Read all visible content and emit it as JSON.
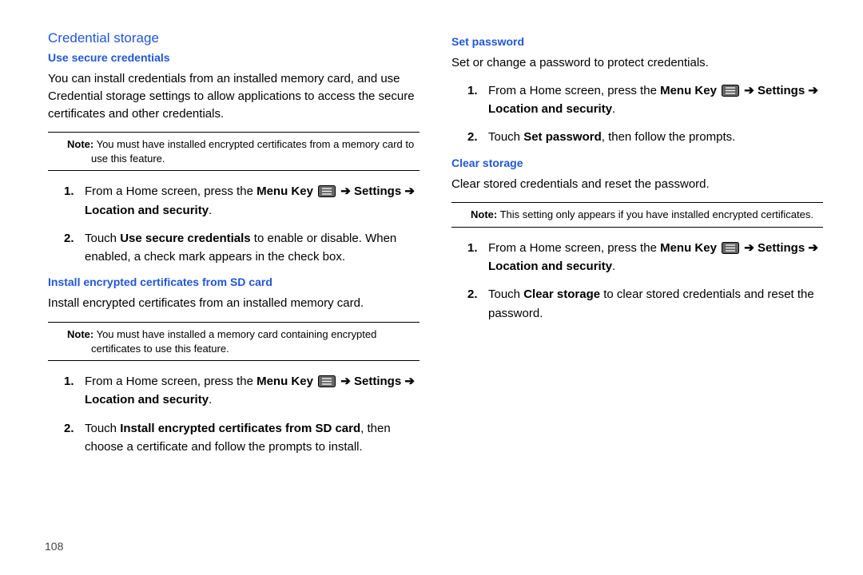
{
  "pageNumber": "108",
  "left": {
    "sectionTitle": "Credential storage",
    "sub1": "Use secure credentials",
    "p1": "You can install credentials from an installed memory card, and use Credential storage settings to allow applications to access the secure certificates and other credentials.",
    "note1_label": "Note:",
    "note1_text": " You must have installed encrypted certificates from a memory card to use this feature.",
    "step1a_pre": "From a Home screen, press the ",
    "step1a_menukey": "Menu Key",
    "step1a_arrow1": " ➔ ",
    "step1a_settings": "Settings",
    "step1a_arrow2": " ➔ ",
    "step1a_locsec": "Location and security",
    "step1a_period": ".",
    "step2a_pre": "Touch ",
    "step2a_bold": "Use secure credentials",
    "step2a_post": " to enable or disable. When enabled, a check mark appears in the check box.",
    "sub2": "Install encrypted certificates from SD card",
    "p2": "Install encrypted certificates from an installed memory card.",
    "note2_label": "Note:",
    "note2_text": " You must have installed a memory card containing encrypted certificates to use this feature.",
    "step1b_pre": "From a Home screen, press the ",
    "step2b_pre": "Touch ",
    "step2b_bold": "Install encrypted certificates from SD card",
    "step2b_post": ", then choose a certificate and follow the prompts to install."
  },
  "right": {
    "sub1": "Set password",
    "p1": "Set or change a password to protect credentials.",
    "step1a_pre": "From a Home screen, press the ",
    "step2a_pre": "Touch ",
    "step2a_bold": "Set password",
    "step2a_post": ", then follow the prompts.",
    "sub2": "Clear storage",
    "p2": "Clear stored credentials and reset the password.",
    "note_label": "Note:",
    "note_text": " This setting only appears if you have installed encrypted certificates.",
    "step1b_pre": "From a Home screen, press the ",
    "step2b_pre": "Touch ",
    "step2b_bold": "Clear storage",
    "step2b_post": " to clear stored credentials and reset the password."
  },
  "shared": {
    "menukey": "Menu Key",
    "arrow": " ➔ ",
    "settings": "Settings",
    "locsec": "Location and security",
    "period": "."
  }
}
